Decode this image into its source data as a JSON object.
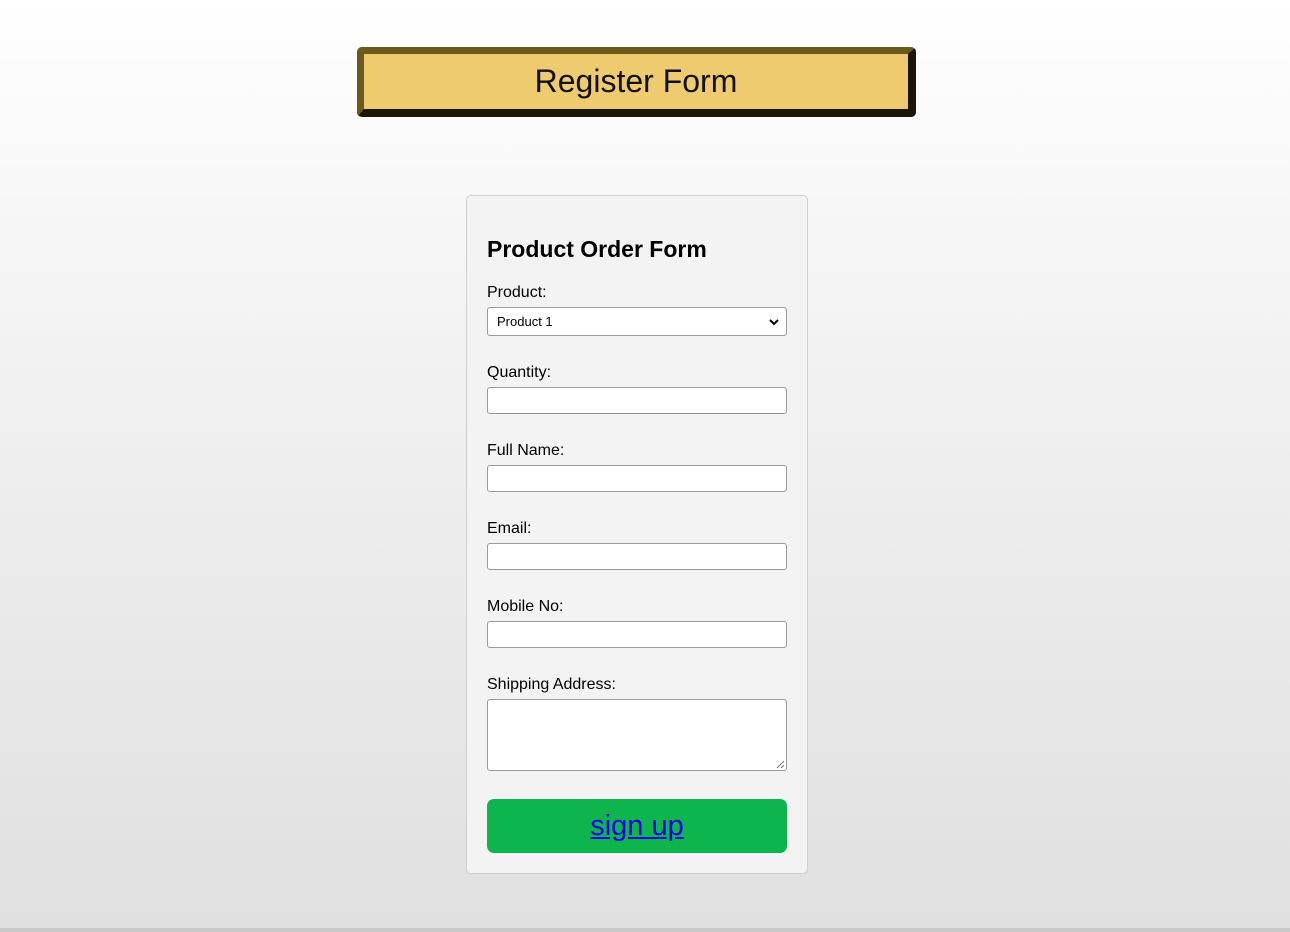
{
  "header": {
    "title": "Register Form"
  },
  "form": {
    "heading": "Product Order Form",
    "product": {
      "label": "Product:",
      "selected": "Product 1"
    },
    "quantity": {
      "label": "Quantity:",
      "value": ""
    },
    "full_name": {
      "label": "Full Name:",
      "value": ""
    },
    "email": {
      "label": "Email:",
      "value": ""
    },
    "mobile": {
      "label": "Mobile No:",
      "value": ""
    },
    "address": {
      "label": "Shipping Address:",
      "value": ""
    },
    "submit_label": "sign up"
  },
  "colors": {
    "banner_bg": "#eecb6f",
    "banner_border_light": "#6b5a1c",
    "banner_border_dark": "#1a1709",
    "card_bg": "#f3f3f3",
    "submit_bg": "#0db54c",
    "link": "#0000ee"
  },
  "icons": {
    "select_arrow": "chevron-down-icon",
    "textarea_resize": "resize-handle-icon"
  }
}
